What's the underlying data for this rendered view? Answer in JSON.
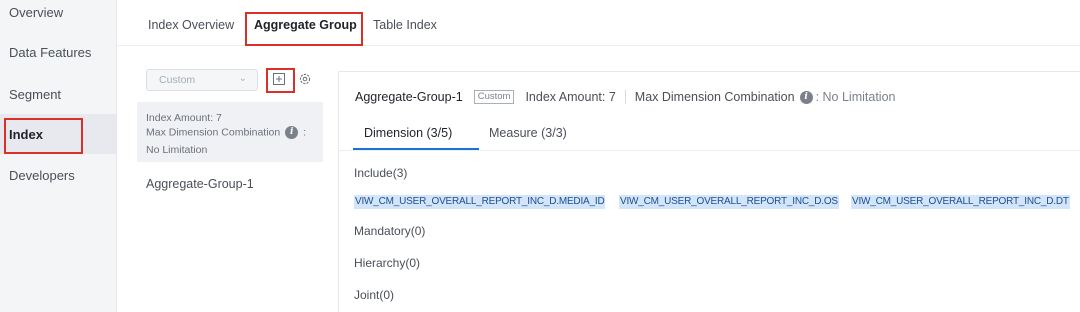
{
  "nav": {
    "items": [
      {
        "label": "Overview"
      },
      {
        "label": "Data Features"
      },
      {
        "label": "Segment"
      },
      {
        "label": "Index"
      },
      {
        "label": "Developers"
      }
    ]
  },
  "tabs": [
    {
      "label": "Index Overview"
    },
    {
      "label": "Aggregate Group"
    },
    {
      "label": "Table Index"
    }
  ],
  "group_list": {
    "select": {
      "value": "Custom"
    },
    "add_icon": "plus-square-icon",
    "settings_icon": "gear-icon",
    "card": {
      "amount": "Index Amount: 7",
      "max_dim_label": "Max Dimension Combination",
      "colon": ":",
      "max_dim_value": "No Limitation"
    },
    "items": [
      {
        "label": "Aggregate-Group-1"
      }
    ]
  },
  "detail": {
    "name": "Aggregate-Group-1",
    "badge": "Custom",
    "amount": "Index Amount: 7",
    "max_dim_label": "Max Dimension Combination",
    "max_dim_value": ": No Limitation",
    "subtabs": [
      {
        "label": "Dimension  (3/5)"
      },
      {
        "label": "Measure  (3/3)"
      }
    ],
    "include_label": "Include(3)",
    "include_items": [
      "VIW_CM_USER_OVERALL_REPORT_INC_D.MEDIA_ID",
      "VIW_CM_USER_OVERALL_REPORT_INC_D.OS",
      "VIW_CM_USER_OVERALL_REPORT_INC_D.DT"
    ],
    "mandatory_label": "Mandatory(0)",
    "hierarchy_label": "Hierarchy(0)",
    "joint_label": "Joint(0)"
  },
  "colors": {
    "highlight_box": "#d9302a",
    "accent": "#1774d6",
    "chip_bg": "#d2e5fb"
  }
}
